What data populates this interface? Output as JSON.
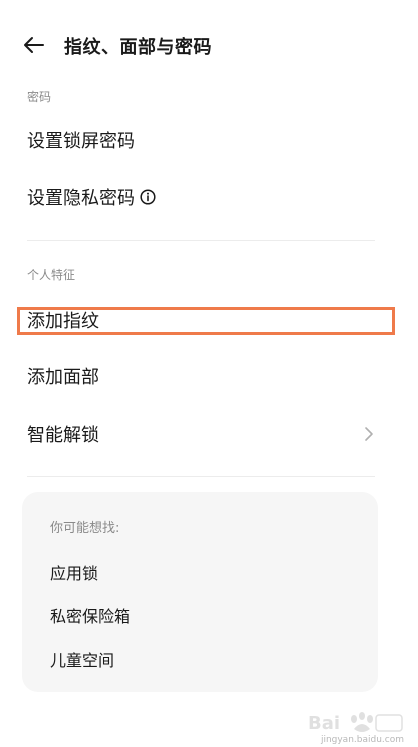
{
  "header": {
    "title": "指纹、面部与密码"
  },
  "sections": {
    "password": {
      "title": "密码",
      "items": [
        {
          "label": "设置锁屏密码"
        },
        {
          "label": "设置隐私密码"
        }
      ]
    },
    "personal": {
      "title": "个人特征",
      "items": [
        {
          "label": "添加指纹"
        },
        {
          "label": "添加面部"
        },
        {
          "label": "智能解锁"
        }
      ]
    }
  },
  "suggestions": {
    "title": "你可能想找:",
    "items": [
      {
        "label": "应用锁"
      },
      {
        "label": "私密保险箱"
      },
      {
        "label": "儿童空间"
      }
    ]
  },
  "watermark": {
    "brand": "Bai",
    "site": "jingyan.baidu.com"
  },
  "colors": {
    "highlight": "#ef7a4a",
    "card_bg": "#f6f6f6",
    "section_text": "#8a8a8a"
  },
  "icons": {
    "back": "arrow-left-icon",
    "info": "info-circle-icon",
    "chevron": "chevron-right-icon"
  }
}
